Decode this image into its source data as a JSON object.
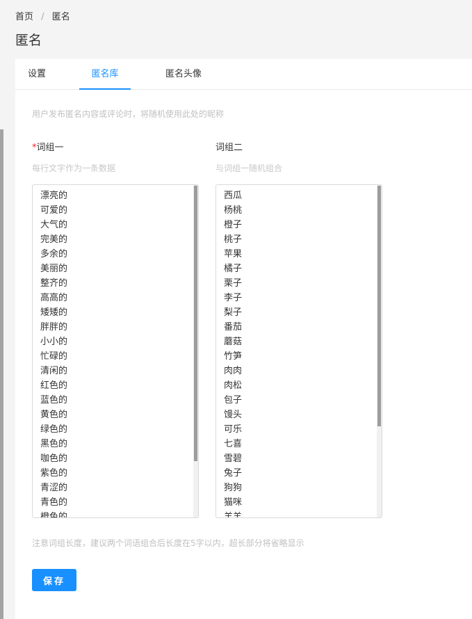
{
  "breadcrumb": {
    "home": "首页",
    "separator": "/",
    "current": "匿名"
  },
  "page_title": "匿名",
  "tabs": [
    {
      "label": "设置",
      "active": false
    },
    {
      "label": "匿名库",
      "active": true
    },
    {
      "label": "匿名头像",
      "active": false
    }
  ],
  "hint": "用户发布匿名内容或评论时，将随机使用此处的昵称",
  "group1": {
    "required_mark": "*",
    "label": "词组一",
    "sub": "每行文字作为一条数据",
    "lines": [
      "漂亮的",
      "可爱的",
      "大气的",
      "完美的",
      "多余的",
      "美丽的",
      "整齐的",
      "高高的",
      "矮矮的",
      "胖胖的",
      "小小的",
      "忙碌的",
      "清闲的",
      "红色的",
      "蓝色的",
      "黄色的",
      "绿色的",
      "黑色的",
      "咖色的",
      "紫色的",
      "青涩的",
      "青色的",
      "橙色的"
    ]
  },
  "group2": {
    "label": "词组二",
    "sub": "与词组一随机组合",
    "lines": [
      "西瓜",
      "杨桃",
      "橙子",
      "桃子",
      "苹果",
      "橘子",
      "栗子",
      "李子",
      "梨子",
      "番茄",
      "蘑菇",
      "竹笋",
      "肉肉",
      "肉松",
      "包子",
      "馒头",
      "可乐",
      "七喜",
      "雪碧",
      "兔子",
      "狗狗",
      "猫咪",
      "羊羊"
    ]
  },
  "bottom_note": "注意词组长度，建议两个词语组合后长度在5字以内，超长部分将省略显示",
  "save_label": "保存",
  "colors": {
    "accent": "#1890ff",
    "required": "#f5222d"
  }
}
